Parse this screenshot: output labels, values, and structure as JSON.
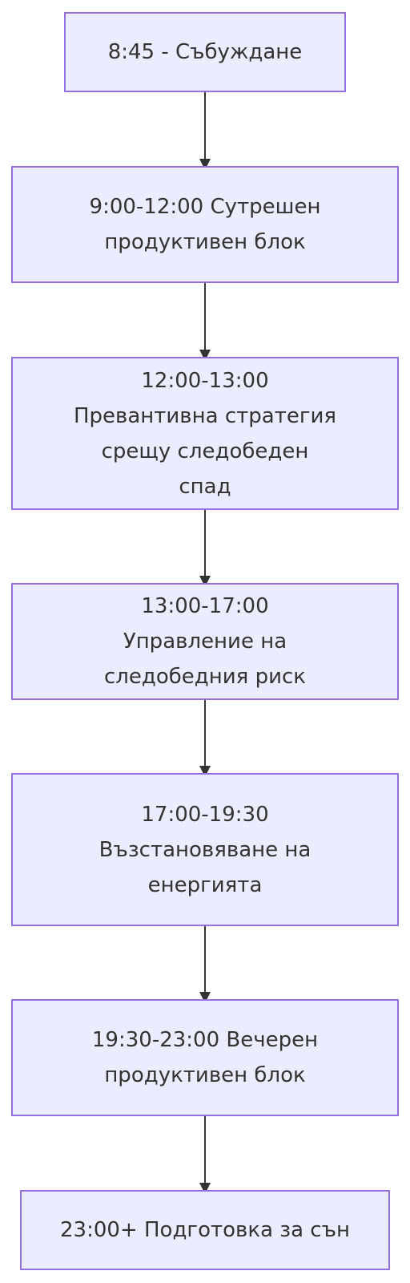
{
  "flowchart": {
    "nodes": [
      {
        "id": "wake",
        "label": "8:45 - Събуждане"
      },
      {
        "id": "morning",
        "label": "9:00-12:00 Сутрешен продуктивен блок"
      },
      {
        "id": "prevent",
        "label": "12:00-13:00 Превантивна стратегия срещу следобеден спад"
      },
      {
        "id": "afternoon",
        "label": "13:00-17:00 Управление на следобедния риск"
      },
      {
        "id": "recover",
        "label": "17:00-19:30 Възстановяване на енергията"
      },
      {
        "id": "evening",
        "label": "19:30-23:00 Вечерен продуктивен блок"
      },
      {
        "id": "sleep",
        "label": "23:00+ Подготовка за сън"
      }
    ],
    "edges": [
      {
        "from": "wake",
        "to": "morning"
      },
      {
        "from": "morning",
        "to": "prevent"
      },
      {
        "from": "prevent",
        "to": "afternoon"
      },
      {
        "from": "afternoon",
        "to": "recover"
      },
      {
        "from": "recover",
        "to": "evening"
      },
      {
        "from": "evening",
        "to": "sleep"
      }
    ],
    "colors": {
      "node_fill": "#ECECFF",
      "node_border": "#9370DB",
      "edge": "#333333",
      "text": "#333333"
    }
  }
}
